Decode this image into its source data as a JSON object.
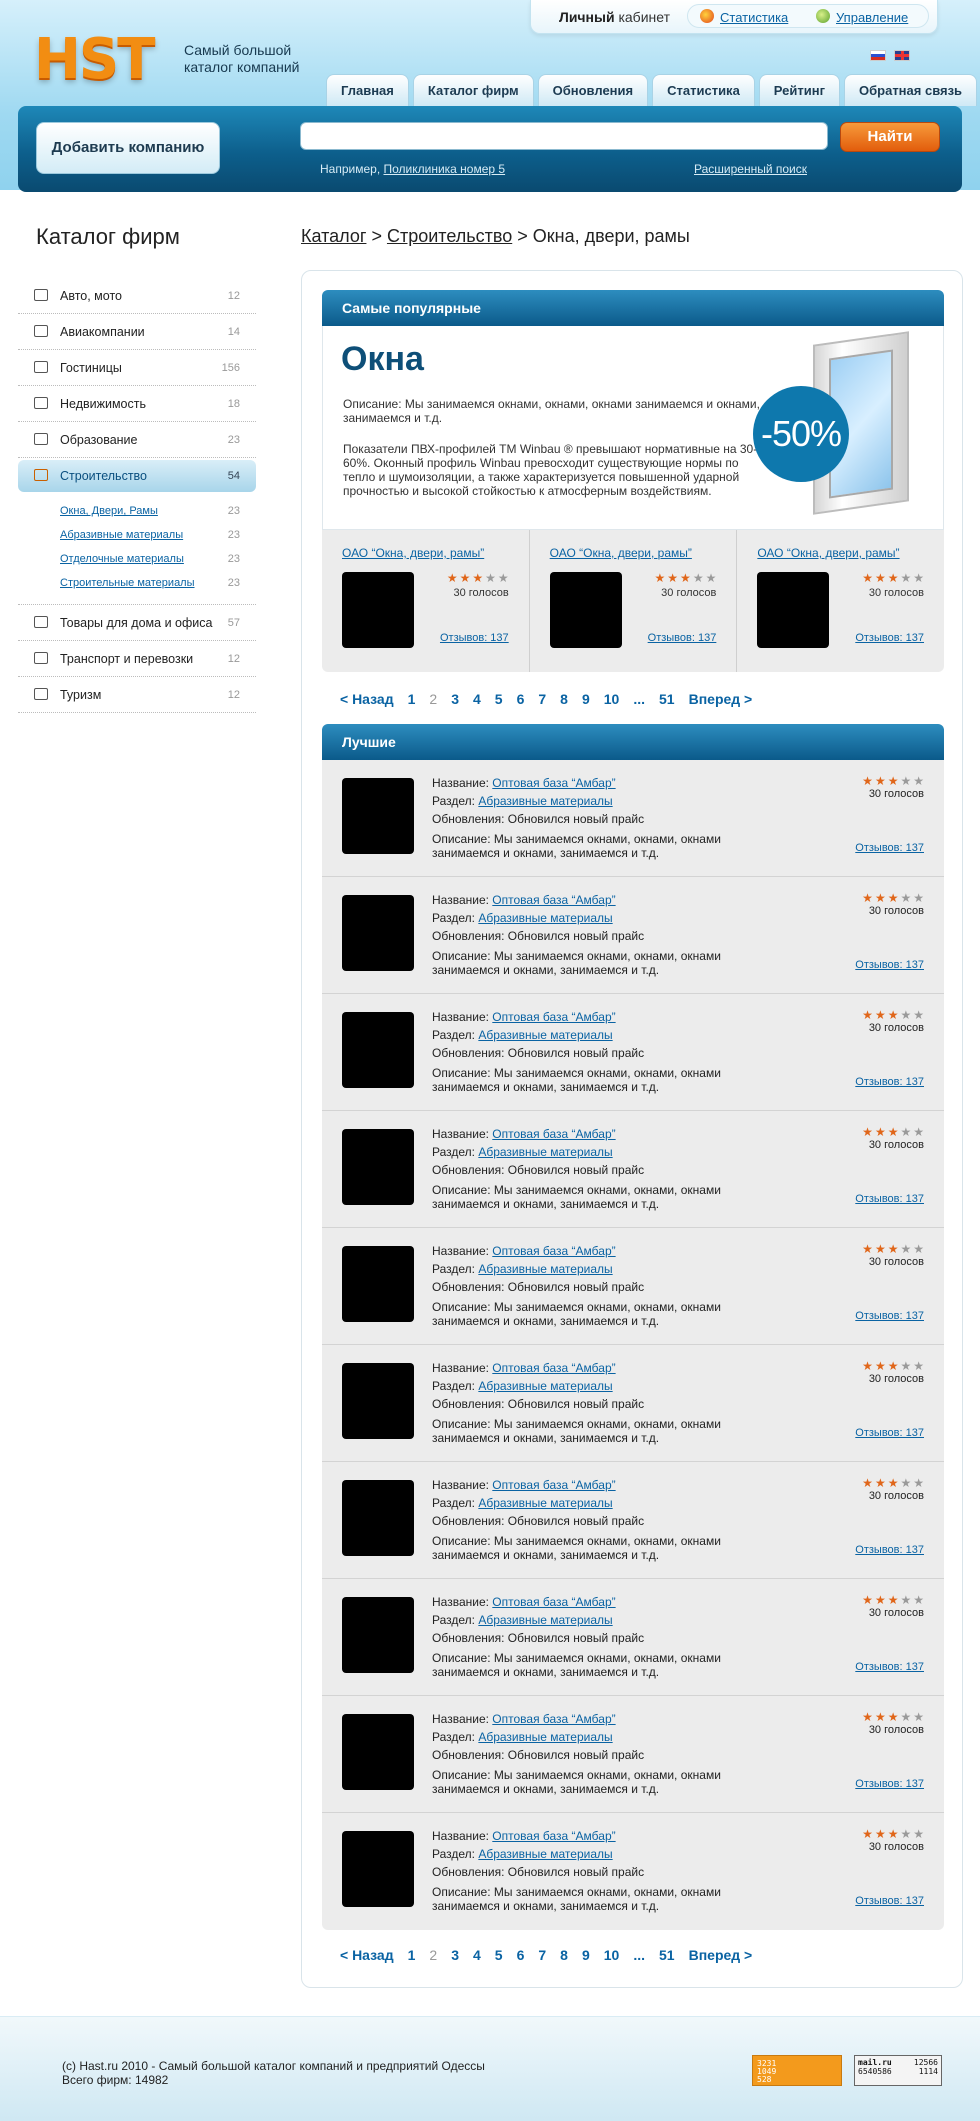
{
  "header": {
    "logo": "HST",
    "tagline": "Самый большой каталог компаний",
    "cabinet_bold": "Личный",
    "cabinet_rest": " кабинет",
    "stats_link": "Статистика",
    "manage_link": "Управление"
  },
  "nav": {
    "tabs": [
      "Главная",
      "Каталог фирм",
      "Обновления",
      "Статистика",
      "Рейтинг",
      "Обратная связь"
    ]
  },
  "search": {
    "add_company": "Добавить компанию",
    "placeholder": "",
    "button": "Найти",
    "example_prefix": "Например, ",
    "example_link": "Поликлиника номер 5",
    "advanced": "Расширенный поиск"
  },
  "sidebar": {
    "title": "Каталог фирм",
    "items": [
      {
        "label": "Авто, мото",
        "count": "12"
      },
      {
        "label": "Авиакомпании",
        "count": "14"
      },
      {
        "label": "Гостиницы",
        "count": "156"
      },
      {
        "label": "Недвижимость",
        "count": "18"
      },
      {
        "label": "Образование",
        "count": "23"
      },
      {
        "label": "Строительство",
        "count": "54"
      },
      {
        "label": "Товары для дома и офиса",
        "count": "57"
      },
      {
        "label": "Транспорт и перевозки",
        "count": "12"
      },
      {
        "label": "Туризм",
        "count": "12"
      }
    ],
    "subitems": [
      {
        "label": "Окна, Двери, Рамы",
        "count": "23"
      },
      {
        "label": "Абразивные материалы",
        "count": "23"
      },
      {
        "label": "Отделочные материалы",
        "count": "23"
      },
      {
        "label": "Строительные материалы",
        "count": "23"
      }
    ]
  },
  "breadcrumb": {
    "catalog": "Каталог",
    "sep": " > ",
    "construction": "Строительство",
    "current": "Окна, двери, рамы"
  },
  "popular": {
    "header": "Самые популярные",
    "promo_title": "Окна",
    "promo_desc": "Описание: Мы занимаемся окнами, окнами, окнами занимаемся и окнами, занимаемся и т.д.",
    "promo_text": "Показатели ПВХ-профилей ТМ Winbau ® превышают нормативные на 30-60%. Оконный профиль Winbau превосходит существующие нормы по тепло и шумоизоляции, а также характеризуется повышенной ударной прочностью и высокой стойкостью к атмосферным воздействиям.",
    "discount": "-50%",
    "featured": [
      {
        "name": "ОАО “Окна, двери, рамы”",
        "rating": 3,
        "votes": "30 голосов",
        "reviews": "Отзывов: 137"
      },
      {
        "name": "ОАО “Окна, двери, рамы”",
        "rating": 3,
        "votes": "30 голосов",
        "reviews": "Отзывов: 137"
      },
      {
        "name": "ОАО “Окна, двери, рамы”",
        "rating": 3,
        "votes": "30 голосов",
        "reviews": "Отзывов: 137"
      }
    ]
  },
  "pager": {
    "prev": "< Назад",
    "pages": [
      "1",
      "2",
      "3",
      "4",
      "5",
      "6",
      "7",
      "8",
      "9",
      "10",
      "...",
      "51"
    ],
    "current": "2",
    "next": "Вперед >"
  },
  "best": {
    "header": "Лучшие",
    "name_label": "Название: ",
    "section_label": "Раздел: ",
    "items": [
      {
        "name": "Оптовая база “Амбар”",
        "section": "Абразивные материалы",
        "update": "Обновления: Обновился новый прайс",
        "desc": "Описание: Мы занимаемся окнами, окнами, окнами занимаемся и окнами, занимаемся и т.д.",
        "rating": 3,
        "votes": "30 голосов",
        "reviews": "Отзывов: 137"
      },
      {
        "name": "Оптовая база “Амбар”",
        "section": "Абразивные материалы",
        "update": "Обновления: Обновился новый прайс",
        "desc": "Описание: Мы занимаемся окнами, окнами, окнами занимаемся и окнами, занимаемся и т.д.",
        "rating": 3,
        "votes": "30 голосов",
        "reviews": "Отзывов: 137"
      },
      {
        "name": "Оптовая база “Амбар”",
        "section": "Абразивные материалы",
        "update": "Обновления: Обновился новый прайс",
        "desc": "Описание: Мы занимаемся окнами, окнами, окнами занимаемся и окнами, занимаемся и т.д.",
        "rating": 3,
        "votes": "30 голосов",
        "reviews": "Отзывов: 137"
      },
      {
        "name": "Оптовая база “Амбар”",
        "section": "Абразивные материалы",
        "update": "Обновления: Обновился новый прайс",
        "desc": "Описание: Мы занимаемся окнами, окнами, окнами занимаемся и окнами, занимаемся и т.д.",
        "rating": 3,
        "votes": "30 голосов",
        "reviews": "Отзывов: 137"
      },
      {
        "name": "Оптовая база “Амбар”",
        "section": "Абразивные материалы",
        "update": "Обновления: Обновился новый прайс",
        "desc": "Описание: Мы занимаемся окнами, окнами, окнами занимаемся и окнами, занимаемся и т.д.",
        "rating": 3,
        "votes": "30 голосов",
        "reviews": "Отзывов: 137"
      },
      {
        "name": "Оптовая база “Амбар”",
        "section": "Абразивные материалы",
        "update": "Обновления: Обновился новый прайс",
        "desc": "Описание: Мы занимаемся окнами, окнами, окнами занимаемся и окнами, занимаемся и т.д.",
        "rating": 3,
        "votes": "30 голосов",
        "reviews": "Отзывов: 137"
      },
      {
        "name": "Оптовая база “Амбар”",
        "section": "Абразивные материалы",
        "update": "Обновления: Обновился новый прайс",
        "desc": "Описание: Мы занимаемся окнами, окнами, окнами занимаемся и окнами, занимаемся и т.д.",
        "rating": 3,
        "votes": "30 голосов",
        "reviews": "Отзывов: 137"
      },
      {
        "name": "Оптовая база “Амбар”",
        "section": "Абразивные материалы",
        "update": "Обновления: Обновился новый прайс",
        "desc": "Описание: Мы занимаемся окнами, окнами, окнами занимаемся и окнами, занимаемся и т.д.",
        "rating": 3,
        "votes": "30 голосов",
        "reviews": "Отзывов: 137"
      },
      {
        "name": "Оптовая база “Амбар”",
        "section": "Абразивные материалы",
        "update": "Обновления: Обновился новый прайс",
        "desc": "Описание: Мы занимаемся окнами, окнами, окнами занимаемся и окнами, занимаемся и т.д.",
        "rating": 3,
        "votes": "30 голосов",
        "reviews": "Отзывов: 137"
      },
      {
        "name": "Оптовая база “Амбар”",
        "section": "Абразивные материалы",
        "update": "Обновления: Обновился новый прайс",
        "desc": "Описание: Мы занимаемся окнами, окнами, окнами занимаемся и окнами, занимаемся и т.д.",
        "rating": 3,
        "votes": "30 голосов",
        "reviews": "Отзывов: 137"
      }
    ]
  },
  "footer": {
    "copyright": "(с) Hast.ru 2010  -  Самый большой каталог компаний и предприятий Одессы",
    "total": "Всего фирм: 14982",
    "counter1": [
      "3231",
      "1049",
      "528"
    ],
    "counter2_logo": "mail.ru",
    "counter2": [
      "12566",
      "6540586",
      "1114"
    ]
  },
  "colors": {
    "accent_blue": "#0b5a8a",
    "link": "#0a63a3",
    "search_button": "#e25d0c",
    "star_on": "#e0661a"
  }
}
